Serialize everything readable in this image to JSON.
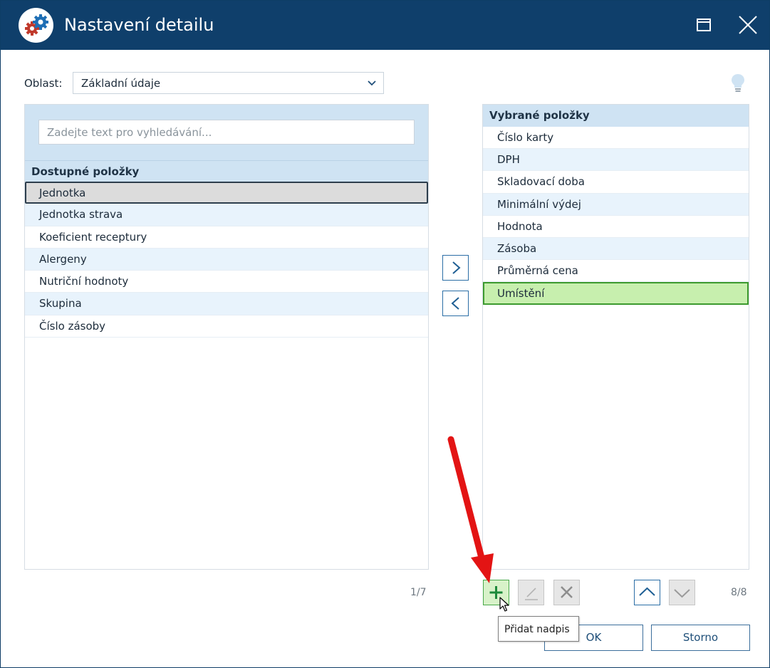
{
  "window": {
    "title": "Nastavení detailu",
    "title_bar_color": "#0f3f6b"
  },
  "oblast": {
    "label": "Oblast:",
    "selected": "Základní údaje"
  },
  "search": {
    "placeholder": "Zadejte text pro vyhledávání..."
  },
  "available": {
    "title": "Dostupné položky",
    "items": [
      "Jednotka",
      "Jednotka strava",
      "Koeficient receptury",
      "Alergeny",
      "Nutriční hodnoty",
      "Skupina",
      "Číslo zásoby"
    ],
    "selected_index": 0,
    "counter": "1/7"
  },
  "selected": {
    "title": "Vybrané položky",
    "items": [
      "Číslo karty",
      "DPH",
      "Skladovací doba",
      "Minimální výdej",
      "Hodnota",
      "Zásoba",
      "Průměrná cena",
      "Umístění"
    ],
    "selected_index": 7,
    "counter": "8/8"
  },
  "tooltip": "Přidat nadpis",
  "buttons": {
    "ok": "OK",
    "cancel": "Storno"
  },
  "icons": {
    "app": "gears-icon",
    "maximize": "maximize-icon",
    "close": "close-icon",
    "hint": "lightbulb-icon",
    "move_right": "chevron-right-icon",
    "move_left": "chevron-left-icon",
    "add": "plus-icon",
    "edit": "pencil-icon",
    "delete": "x-icon",
    "move_up": "chevron-up-icon",
    "move_down": "chevron-down-icon"
  },
  "colors": {
    "accent": "#2b6ea6",
    "list_header": "#cfe3f3",
    "selected_green": "#c7efae",
    "annotation_red": "#e31414"
  }
}
